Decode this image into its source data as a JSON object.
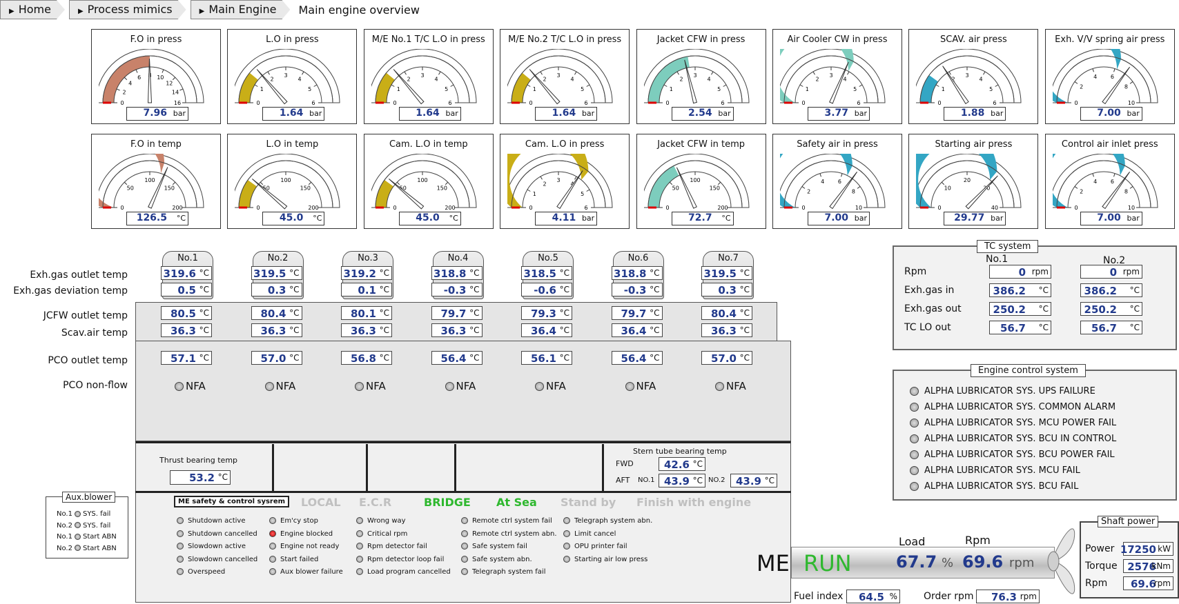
{
  "breadcrumb": {
    "items": [
      "Home",
      "Process mimics",
      "Main Engine"
    ],
    "current": "Main engine overview"
  },
  "colors": {
    "fo": "#c8826a",
    "lo": "#c9ae17",
    "cfw": "#7dcdbd",
    "air": "#33a6c4",
    "value": "#223a8c",
    "run": "#2eb82e"
  },
  "gauges_row1": [
    {
      "title": "F.O in press",
      "value": "7.96",
      "unit": "bar",
      "ticks": [
        "0",
        "2",
        "4",
        "6",
        "8",
        "10",
        "12",
        "14",
        "16"
      ],
      "max": 16,
      "val": 7.96,
      "band": 0.5,
      "color": "fo"
    },
    {
      "title": "L.O in press",
      "value": "1.64",
      "unit": "bar",
      "ticks": [
        "0",
        "1",
        "2",
        "3",
        "4",
        "5",
        "6"
      ],
      "max": 6,
      "val": 1.64,
      "band": 0.22,
      "color": "lo"
    },
    {
      "title": "M/E No.1 T/C L.O in press",
      "value": "1.64",
      "unit": "bar",
      "ticks": [
        "0",
        "1",
        "2",
        "3",
        "4",
        "5",
        "6"
      ],
      "max": 6,
      "val": 1.64,
      "band": 0.22,
      "color": "lo"
    },
    {
      "title": "M/E No.2 T/C L.O in press",
      "value": "1.64",
      "unit": "bar",
      "ticks": [
        "0",
        "1",
        "2",
        "3",
        "4",
        "5",
        "6"
      ],
      "max": 6,
      "val": 1.64,
      "band": 0.22,
      "color": "lo"
    },
    {
      "title": "Jacket CFW in press",
      "value": "2.54",
      "unit": "bar",
      "ticks": [
        "0",
        "1",
        "2",
        "3",
        "4",
        "5",
        "6"
      ],
      "max": 6,
      "val": 2.54,
      "band": 0.45,
      "color": "cfw"
    },
    {
      "title": "Air Cooler CW in press",
      "value": "3.77",
      "unit": "bar",
      "ticks": [
        "0",
        "1",
        "2",
        "3",
        "4",
        "5",
        "6"
      ],
      "max": 6,
      "val": 3.77,
      "band": 0.66,
      "color": "cfw"
    },
    {
      "title": "SCAV. air press",
      "value": "1.88",
      "unit": "bar",
      "ticks": [
        "0",
        "1",
        "2",
        "3",
        "4",
        "5",
        "6"
      ],
      "max": 6,
      "val": 1.88,
      "band": 0.2,
      "color": "air"
    },
    {
      "title": "Exh. V/V spring air press",
      "value": "7.00",
      "unit": "bar",
      "ticks": [
        "0",
        "2",
        "4",
        "6",
        "8",
        "10"
      ],
      "max": 10,
      "val": 7.0,
      "band": 0.62,
      "color": "air"
    }
  ],
  "gauges_row2": [
    {
      "title": "F.O in temp",
      "value": "126.5",
      "unit": "°C",
      "ticks": [
        "0",
        "50",
        "100",
        "150",
        "200"
      ],
      "max": 200,
      "val": 126.5,
      "band": 0.6,
      "color": "fo"
    },
    {
      "title": "L.O in temp",
      "value": "45.0",
      "unit": "°C",
      "ticks": [
        "0",
        "50",
        "100",
        "150",
        "200"
      ],
      "max": 200,
      "val": 45,
      "band": 0.2,
      "color": "lo"
    },
    {
      "title": "Cam. L.O in temp",
      "value": "45.0",
      "unit": "°C",
      "ticks": [
        "0",
        "50",
        "100",
        "150",
        "200"
      ],
      "max": 200,
      "val": 45,
      "band": 0.2,
      "color": "lo"
    },
    {
      "title": "Cam. L.O in press",
      "value": "4.11",
      "unit": "bar",
      "ticks": [
        "0",
        "1",
        "2",
        "3",
        "4",
        "5",
        "6"
      ],
      "max": 6,
      "val": 4.11,
      "band": 0.72,
      "color": "lo"
    },
    {
      "title": "Jacket CFW in temp",
      "value": "72.7",
      "unit": "°C",
      "ticks": [
        "0",
        "50",
        "100",
        "150",
        "200"
      ],
      "max": 200,
      "val": 72.7,
      "band": 0.35,
      "color": "cfw"
    },
    {
      "title": "Safety air in press",
      "value": "7.00",
      "unit": "bar",
      "ticks": [
        "0",
        "2",
        "4",
        "6",
        "8",
        "10"
      ],
      "max": 10,
      "val": 7.0,
      "band": 0.65,
      "color": "air"
    },
    {
      "title": "Starting air press",
      "value": "29.77",
      "unit": "bar",
      "ticks": [
        "0",
        "10",
        "20",
        "30",
        "40"
      ],
      "max": 40,
      "val": 29.77,
      "band": 0.72,
      "color": "air"
    },
    {
      "title": "Control air inlet press",
      "value": "7.00",
      "unit": "bar",
      "ticks": [
        "0",
        "2",
        "4",
        "6",
        "8",
        "10"
      ],
      "max": 10,
      "val": 7.0,
      "band": 0.65,
      "color": "air"
    }
  ],
  "row_labels": {
    "exh_out": "Exh.gas outlet temp",
    "exh_dev": "Exh.gas deviation temp",
    "jcfw": "JCFW outlet temp",
    "scav": "Scav.air temp",
    "pco": "PCO outlet temp",
    "pco_nf": "PCO non-flow"
  },
  "unit_c": "°C",
  "nfa": "NFA",
  "cylinders": [
    {
      "name": "No.1",
      "exh": "319.6",
      "dev": "0.5",
      "jcfw": "80.5",
      "scav": "36.3",
      "pco": "57.1"
    },
    {
      "name": "No.2",
      "exh": "319.5",
      "dev": "0.3",
      "jcfw": "80.4",
      "scav": "36.3",
      "pco": "57.0"
    },
    {
      "name": "No.3",
      "exh": "319.2",
      "dev": "0.1",
      "jcfw": "80.1",
      "scav": "36.3",
      "pco": "56.8"
    },
    {
      "name": "No.4",
      "exh": "318.8",
      "dev": "-0.3",
      "jcfw": "79.7",
      "scav": "36.3",
      "pco": "56.4"
    },
    {
      "name": "No.5",
      "exh": "318.5",
      "dev": "-0.6",
      "jcfw": "79.3",
      "scav": "36.4",
      "pco": "56.1"
    },
    {
      "name": "No.6",
      "exh": "318.8",
      "dev": "-0.3",
      "jcfw": "79.7",
      "scav": "36.4",
      "pco": "56.4"
    },
    {
      "name": "No.7",
      "exh": "319.5",
      "dev": "0.3",
      "jcfw": "80.4",
      "scav": "36.3",
      "pco": "57.0"
    }
  ],
  "thrust": {
    "label": "Thrust bearing temp",
    "value": "53.2"
  },
  "stern": {
    "label": "Stern tube bearing temp",
    "fwd_label": "FWD",
    "fwd": "42.6",
    "aft_label": "AFT",
    "no1_label": "NO.1",
    "no1": "43.9",
    "no2_label": "NO.2",
    "no2": "43.9"
  },
  "tc": {
    "title": "TC system",
    "col1": "No.1",
    "col2": "No.2",
    "rpm_unit": "rpm",
    "rows": [
      {
        "label": "Rpm",
        "v1": "0",
        "v2": "0",
        "unit": "rpm"
      },
      {
        "label": "Exh.gas in",
        "v1": "386.2",
        "v2": "386.2",
        "unit": "°C"
      },
      {
        "label": "Exh.gas out",
        "v1": "250.2",
        "v2": "250.2",
        "unit": "°C"
      },
      {
        "label": "TC LO out",
        "v1": "56.7",
        "v2": "56.7",
        "unit": "°C"
      }
    ]
  },
  "ecs": {
    "title": "Engine control system",
    "alarms": [
      "ALPHA LUBRICATOR SYS. UPS FAILURE",
      "ALPHA LUBRICATOR SYS. COMMON ALARM",
      "ALPHA LUBRICATOR SYS. MCU POWER FAIL",
      "ALPHA LUBRICATOR SYS. BCU IN CONTROL",
      "ALPHA LUBRICATOR SYS. BCU POWER FAIL",
      "ALPHA LUBRICATOR SYS. MCU FAIL",
      "ALPHA LUBRICATOR SYS. BCU FAIL"
    ]
  },
  "aux_blower": {
    "title": "Aux.blower",
    "items": [
      {
        "no": "No.1",
        "label": "SYS. fail"
      },
      {
        "no": "No.2",
        "label": "SYS. fail"
      },
      {
        "no": "No.1",
        "label": "Start ABN"
      },
      {
        "no": "No.2",
        "label": "Start ABN"
      }
    ]
  },
  "safety": {
    "title": "ME safety & control sysrem",
    "modes": [
      {
        "label": "LOCAL",
        "on": false
      },
      {
        "label": "E.C.R",
        "on": false
      },
      {
        "label": "BRIDGE",
        "on": true
      },
      {
        "label": "At Sea",
        "on": true
      },
      {
        "label": "Stand by",
        "on": false
      },
      {
        "label": "Finish with engine",
        "on": false
      }
    ],
    "columns": [
      [
        {
          "label": "Shutdown active",
          "red": false
        },
        {
          "label": "Shutdown cancelled",
          "red": false
        },
        {
          "label": "Slowdown active",
          "red": false
        },
        {
          "label": "Slowdown cancelled",
          "red": false
        },
        {
          "label": "Overspeed",
          "red": false
        }
      ],
      [
        {
          "label": "Em'cy stop",
          "red": false
        },
        {
          "label": "Engine blocked",
          "red": true
        },
        {
          "label": "Engine not ready",
          "red": false
        },
        {
          "label": "Start failed",
          "red": false
        },
        {
          "label": "Aux blower failure",
          "red": false
        }
      ],
      [
        {
          "label": "Wrong way",
          "red": false
        },
        {
          "label": "Critical rpm",
          "red": false
        },
        {
          "label": "Rpm detector fail",
          "red": false
        },
        {
          "label": "Rpm detector loop fail",
          "red": false
        },
        {
          "label": "Load program cancelled",
          "red": false
        }
      ],
      [
        {
          "label": "Remote ctrl system fail",
          "red": false
        },
        {
          "label": "Remote ctrl system abn.",
          "red": false
        },
        {
          "label": "Safe system fail",
          "red": false
        },
        {
          "label": "Safe system abn.",
          "red": false
        },
        {
          "label": "Telegraph system fail",
          "red": false
        }
      ],
      [
        {
          "label": "Telegraph system abn.",
          "red": false
        },
        {
          "label": "Limit cancel",
          "red": false
        },
        {
          "label": "OPU printer fail",
          "red": false
        },
        {
          "label": "Starting air low press",
          "red": false
        }
      ]
    ]
  },
  "engine": {
    "me": "ME",
    "status": "RUN",
    "load_label": "Load",
    "load": "67.7",
    "load_unit": "%",
    "rpm_label": "Rpm",
    "rpm": "69.6",
    "rpm_unit": "rpm",
    "fuel_label": "Fuel index",
    "fuel": "64.5",
    "fuel_unit": "%",
    "order_label": "Order rpm",
    "order": "76.3",
    "order_unit": "rpm"
  },
  "shaft": {
    "title": "Shaft power",
    "rows": [
      {
        "label": "Power",
        "value": "17250",
        "unit": "kW"
      },
      {
        "label": "Torque",
        "value": "2576",
        "unit": "kNm"
      },
      {
        "label": "Rpm",
        "value": "69.6",
        "unit": "rpm"
      }
    ]
  }
}
